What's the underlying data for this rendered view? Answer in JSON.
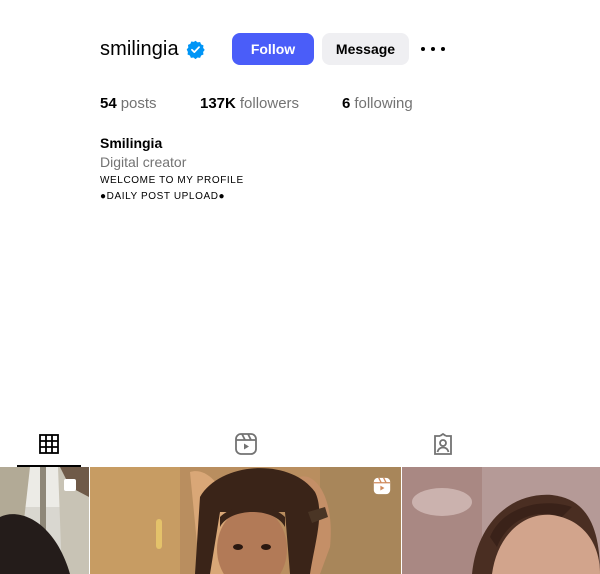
{
  "profile": {
    "username": "smilingia",
    "verified": true,
    "follow_label": "Follow",
    "message_label": "Message"
  },
  "stats": {
    "posts_count": "54",
    "posts_label": "posts",
    "followers_count": "137K",
    "followers_label": "followers",
    "following_count": "6",
    "following_label": "following"
  },
  "bio": {
    "name": "Smilingia",
    "category": "Digital creator",
    "line1": "WELCOME TO MY PROFILE",
    "line2": "●DAILY POST UPLOAD●"
  },
  "tabs": [
    {
      "icon": "grid-icon",
      "active": true
    },
    {
      "icon": "reels-icon",
      "active": false
    },
    {
      "icon": "tagged-icon",
      "active": false
    }
  ],
  "colors": {
    "accent": "#4a5df9",
    "verified": "#0095f6",
    "muted": "#737373",
    "secondary_button": "#efeff2"
  }
}
